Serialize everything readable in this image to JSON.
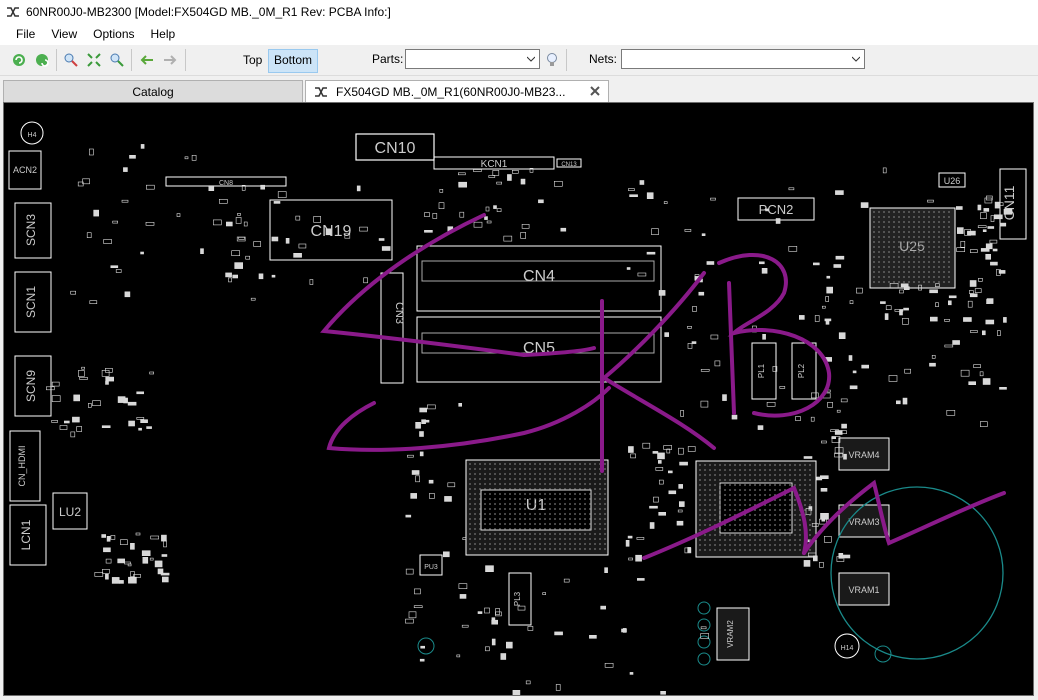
{
  "window": {
    "title": "60NR00J0-MB2300 [Model:FX504GD MB._0M_R1 Rev: PCBA Info:]",
    "icon": "board-view-icon"
  },
  "menu": [
    "File",
    "View",
    "Options",
    "Help"
  ],
  "toolbar": {
    "buttons": [
      "refresh-icon",
      "redo-icon",
      "zoom-in-icon",
      "fit-icon",
      "zoom-out-icon",
      "back-arrow-icon",
      "forward-arrow-icon"
    ],
    "top_label": "Top",
    "bottom_label": "Bottom",
    "active_side": "Bottom",
    "parts_label": "Parts:",
    "parts_value": "",
    "nets_label": "Nets:",
    "nets_value": "",
    "bulb_icon": "lightbulb-icon"
  },
  "tabs": {
    "catalog": "Catalog",
    "board": "FX504GD MB._0M_R1(60NR00J0-MB23..."
  },
  "board": {
    "components": [
      "CN10",
      "KCN1",
      "CN13",
      "CN8",
      "CN19",
      "CN4",
      "CN5",
      "CN3",
      "PCN2",
      "U26",
      "U25",
      "CN11",
      "ACN2",
      "SCN3",
      "SCN1",
      "SCN9",
      "CN_HDMI",
      "LU2",
      "LCN1",
      "U1",
      "VRAM4",
      "VRAM3",
      "VRAM1",
      "VRAM2",
      "PU3",
      "H14",
      "H4",
      "PL3",
      "PL1",
      "PL2"
    ],
    "colors": {
      "background": "#000000",
      "outline": "#ffffff",
      "annotation": "#8a1a8a",
      "hole": "#1a8a8a"
    }
  }
}
